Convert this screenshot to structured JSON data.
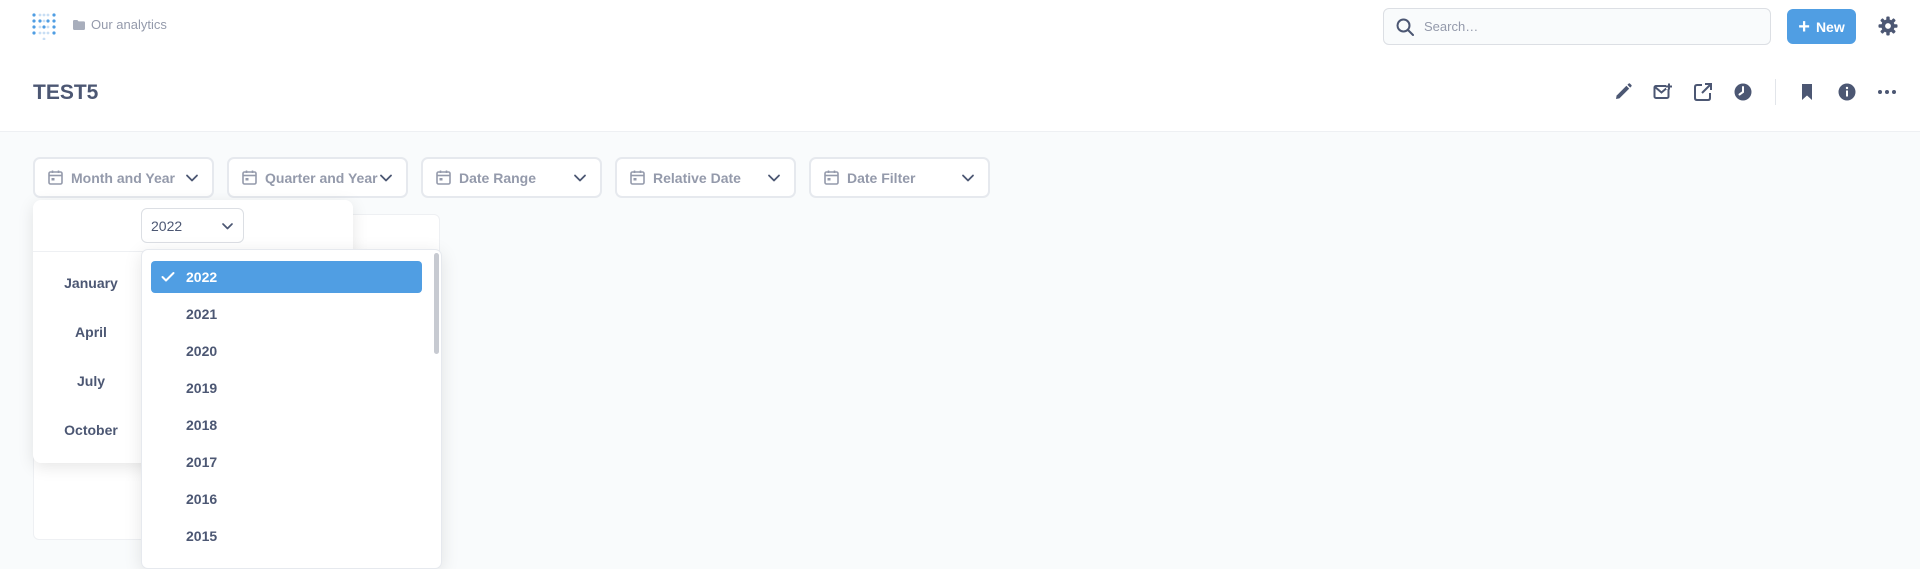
{
  "nav": {
    "breadcrumb": "Our analytics",
    "search_placeholder": "Search…",
    "new_label": "New",
    "icons": [
      "logo-icon",
      "folder-icon",
      "search-icon",
      "plus-icon",
      "gear-icon"
    ]
  },
  "header": {
    "title": "TEST5",
    "actions": [
      "edit-icon",
      "subscription-icon",
      "share-icon",
      "history-icon",
      "bookmark-icon",
      "info-icon",
      "more-icon"
    ]
  },
  "filters": [
    {
      "label": "Month and Year"
    },
    {
      "label": "Quarter and Year"
    },
    {
      "label": "Date Range"
    },
    {
      "label": "Relative Date"
    },
    {
      "label": "Date Filter"
    }
  ],
  "picker": {
    "selected_year": "2022",
    "months": [
      "January",
      "April",
      "July",
      "October"
    ]
  },
  "year_options": {
    "selected": "2022",
    "items": [
      "2022",
      "2021",
      "2020",
      "2019",
      "2018",
      "2017",
      "2016",
      "2015"
    ]
  },
  "colors": {
    "brand": "#509ee3",
    "text": "#4c5773",
    "muted": "#949aab",
    "border": "#e6e9ee"
  }
}
